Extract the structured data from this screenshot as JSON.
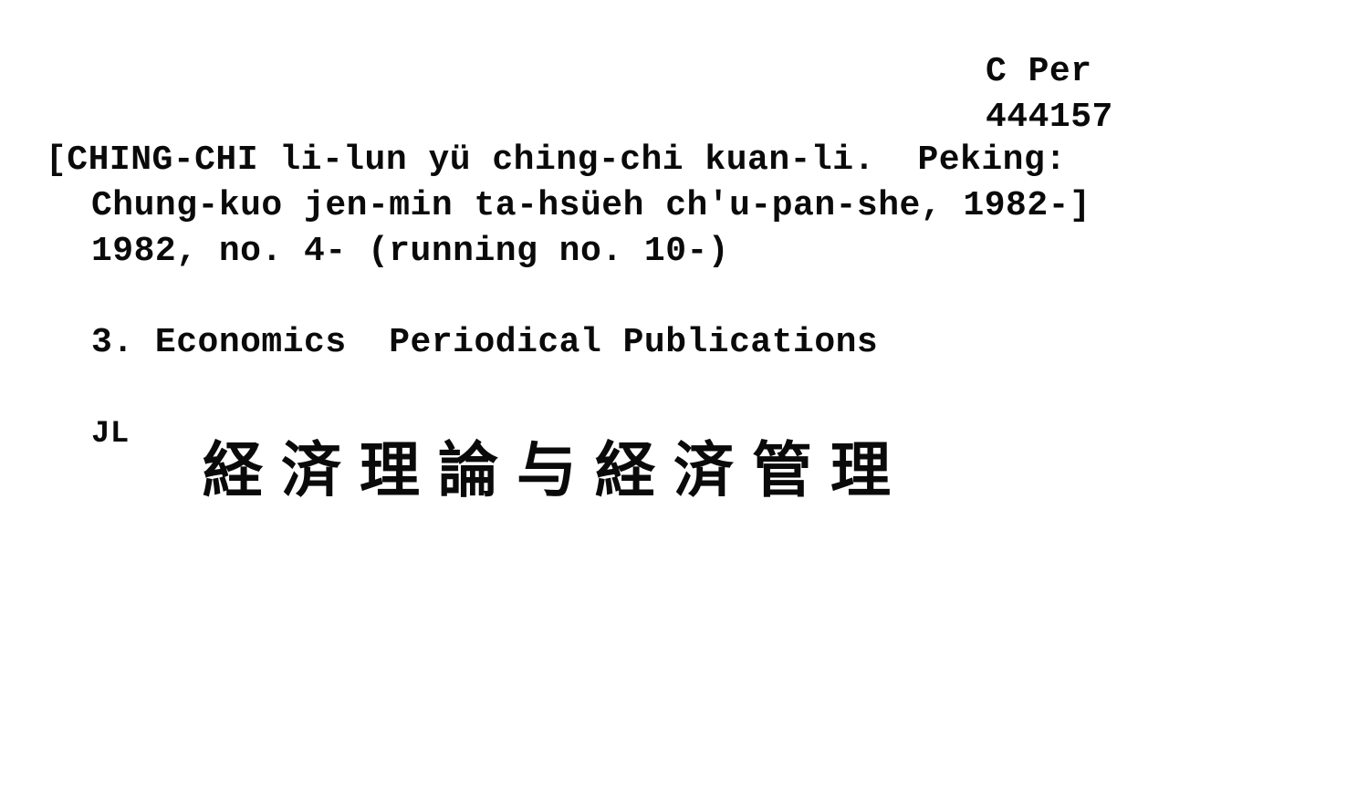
{
  "call_number": {
    "line1": "C Per",
    "line2": "444157"
  },
  "entry": {
    "line1": "[CHING-CHI li-lun yü ching-chi kuan-li.  Peking:",
    "line2": "Chung-kuo jen-min ta-hsüeh ch'u-pan-she, 1982-]",
    "line3": "1982, no. 4- (running no. 10-)"
  },
  "subjects": "3. Economics  Periodical Publications",
  "location_code": "JL",
  "chinese_title": "経済理論与経済管理"
}
